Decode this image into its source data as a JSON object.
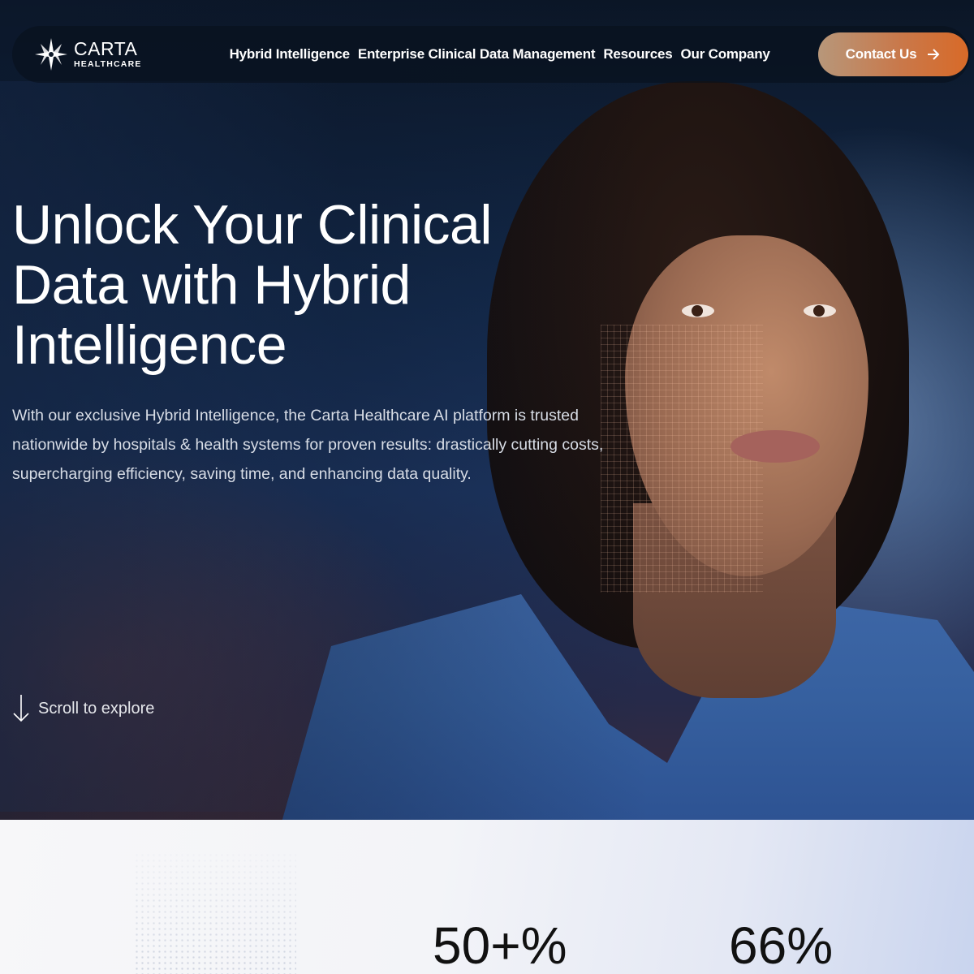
{
  "brand": {
    "name": "CARTA",
    "sub": "HEALTHCARE"
  },
  "nav": {
    "links": [
      "Hybrid Intelligence",
      "Enterprise Clinical Data Management",
      "Resources",
      "Our Company"
    ],
    "cta": "Contact Us"
  },
  "hero": {
    "title": "Unlock Your Clinical Data with Hybrid Intelligence",
    "description": "With our exclusive Hybrid Intelligence, the Carta Healthcare AI platform is trusted nationwide by hospitals & health systems for proven results: drastically cutting costs, supercharging efficiency, saving time, and enhancing data quality.",
    "scroll_label": "Scroll to explore"
  },
  "stats": {
    "items": [
      "50+%",
      "66%"
    ]
  },
  "colors": {
    "cta_gradient_start": "#b7977a",
    "cta_gradient_end": "#d86a28",
    "scrubs_blue": "#3f68a8",
    "nav_bg": "#08101c"
  },
  "icons": {
    "logo": "compass-star-icon",
    "cta_arrow": "arrow-right-icon",
    "scroll": "arrow-down-icon"
  }
}
